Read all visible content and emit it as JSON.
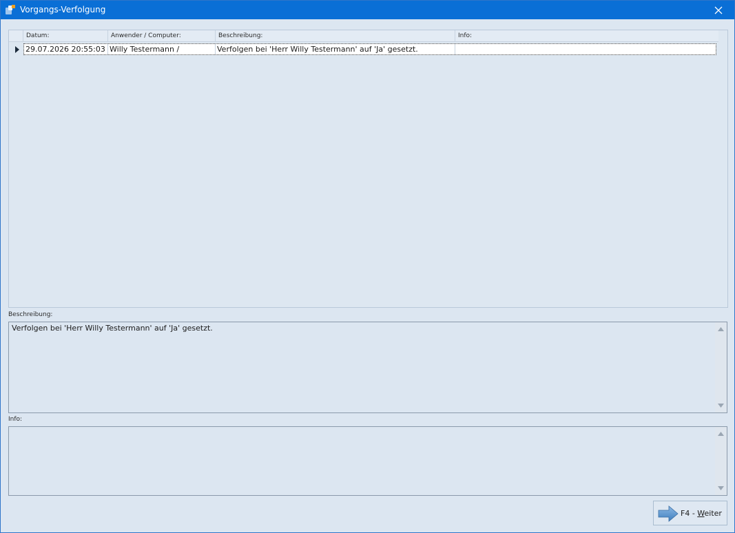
{
  "window": {
    "title": "Vorgangs-Verfolgung"
  },
  "grid": {
    "columns": [
      "Datum:",
      "Anwender / Computer:",
      "Beschreibung:",
      "Info:"
    ],
    "rows": [
      [
        "29.07.2026 20:55:03",
        "Willy Testermann /",
        "Verfolgen bei 'Herr Willy Testermann' auf 'Ja' gesetzt.",
        ""
      ]
    ]
  },
  "beschreibung": {
    "label": "Beschreibung:",
    "value": "Verfolgen bei 'Herr Willy Testermann' auf 'Ja' gesetzt."
  },
  "info": {
    "label": "Info:",
    "value": ""
  },
  "footer": {
    "next_prefix": "F4 - ",
    "next_underline": "W",
    "next_rest": "eiter"
  },
  "colors": {
    "titlebar": "#0a6fd6",
    "background": "#dce6f1",
    "arrow": "#4f8fcf"
  }
}
